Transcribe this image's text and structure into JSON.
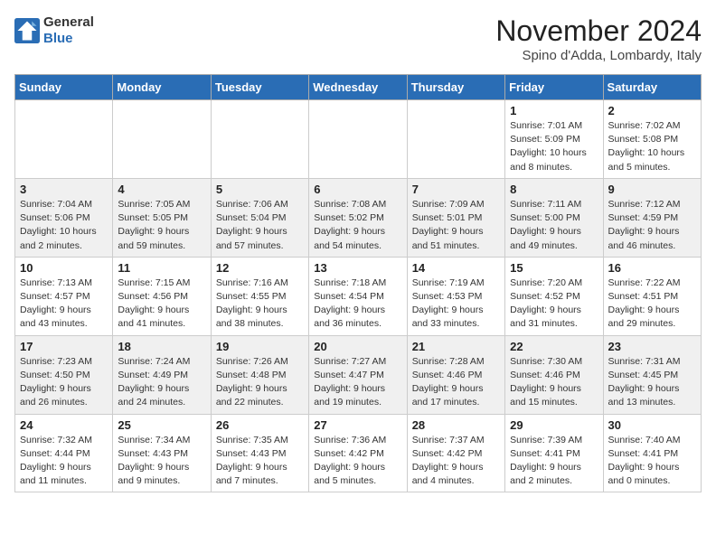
{
  "logo": {
    "line1": "General",
    "line2": "Blue"
  },
  "header": {
    "month": "November 2024",
    "location": "Spino d'Adda, Lombardy, Italy"
  },
  "days_of_week": [
    "Sunday",
    "Monday",
    "Tuesday",
    "Wednesday",
    "Thursday",
    "Friday",
    "Saturday"
  ],
  "weeks": [
    [
      {
        "day": "",
        "info": ""
      },
      {
        "day": "",
        "info": ""
      },
      {
        "day": "",
        "info": ""
      },
      {
        "day": "",
        "info": ""
      },
      {
        "day": "",
        "info": ""
      },
      {
        "day": "1",
        "info": "Sunrise: 7:01 AM\nSunset: 5:09 PM\nDaylight: 10 hours and 8 minutes."
      },
      {
        "day": "2",
        "info": "Sunrise: 7:02 AM\nSunset: 5:08 PM\nDaylight: 10 hours and 5 minutes."
      }
    ],
    [
      {
        "day": "3",
        "info": "Sunrise: 7:04 AM\nSunset: 5:06 PM\nDaylight: 10 hours and 2 minutes."
      },
      {
        "day": "4",
        "info": "Sunrise: 7:05 AM\nSunset: 5:05 PM\nDaylight: 9 hours and 59 minutes."
      },
      {
        "day": "5",
        "info": "Sunrise: 7:06 AM\nSunset: 5:04 PM\nDaylight: 9 hours and 57 minutes."
      },
      {
        "day": "6",
        "info": "Sunrise: 7:08 AM\nSunset: 5:02 PM\nDaylight: 9 hours and 54 minutes."
      },
      {
        "day": "7",
        "info": "Sunrise: 7:09 AM\nSunset: 5:01 PM\nDaylight: 9 hours and 51 minutes."
      },
      {
        "day": "8",
        "info": "Sunrise: 7:11 AM\nSunset: 5:00 PM\nDaylight: 9 hours and 49 minutes."
      },
      {
        "day": "9",
        "info": "Sunrise: 7:12 AM\nSunset: 4:59 PM\nDaylight: 9 hours and 46 minutes."
      }
    ],
    [
      {
        "day": "10",
        "info": "Sunrise: 7:13 AM\nSunset: 4:57 PM\nDaylight: 9 hours and 43 minutes."
      },
      {
        "day": "11",
        "info": "Sunrise: 7:15 AM\nSunset: 4:56 PM\nDaylight: 9 hours and 41 minutes."
      },
      {
        "day": "12",
        "info": "Sunrise: 7:16 AM\nSunset: 4:55 PM\nDaylight: 9 hours and 38 minutes."
      },
      {
        "day": "13",
        "info": "Sunrise: 7:18 AM\nSunset: 4:54 PM\nDaylight: 9 hours and 36 minutes."
      },
      {
        "day": "14",
        "info": "Sunrise: 7:19 AM\nSunset: 4:53 PM\nDaylight: 9 hours and 33 minutes."
      },
      {
        "day": "15",
        "info": "Sunrise: 7:20 AM\nSunset: 4:52 PM\nDaylight: 9 hours and 31 minutes."
      },
      {
        "day": "16",
        "info": "Sunrise: 7:22 AM\nSunset: 4:51 PM\nDaylight: 9 hours and 29 minutes."
      }
    ],
    [
      {
        "day": "17",
        "info": "Sunrise: 7:23 AM\nSunset: 4:50 PM\nDaylight: 9 hours and 26 minutes."
      },
      {
        "day": "18",
        "info": "Sunrise: 7:24 AM\nSunset: 4:49 PM\nDaylight: 9 hours and 24 minutes."
      },
      {
        "day": "19",
        "info": "Sunrise: 7:26 AM\nSunset: 4:48 PM\nDaylight: 9 hours and 22 minutes."
      },
      {
        "day": "20",
        "info": "Sunrise: 7:27 AM\nSunset: 4:47 PM\nDaylight: 9 hours and 19 minutes."
      },
      {
        "day": "21",
        "info": "Sunrise: 7:28 AM\nSunset: 4:46 PM\nDaylight: 9 hours and 17 minutes."
      },
      {
        "day": "22",
        "info": "Sunrise: 7:30 AM\nSunset: 4:46 PM\nDaylight: 9 hours and 15 minutes."
      },
      {
        "day": "23",
        "info": "Sunrise: 7:31 AM\nSunset: 4:45 PM\nDaylight: 9 hours and 13 minutes."
      }
    ],
    [
      {
        "day": "24",
        "info": "Sunrise: 7:32 AM\nSunset: 4:44 PM\nDaylight: 9 hours and 11 minutes."
      },
      {
        "day": "25",
        "info": "Sunrise: 7:34 AM\nSunset: 4:43 PM\nDaylight: 9 hours and 9 minutes."
      },
      {
        "day": "26",
        "info": "Sunrise: 7:35 AM\nSunset: 4:43 PM\nDaylight: 9 hours and 7 minutes."
      },
      {
        "day": "27",
        "info": "Sunrise: 7:36 AM\nSunset: 4:42 PM\nDaylight: 9 hours and 5 minutes."
      },
      {
        "day": "28",
        "info": "Sunrise: 7:37 AM\nSunset: 4:42 PM\nDaylight: 9 hours and 4 minutes."
      },
      {
        "day": "29",
        "info": "Sunrise: 7:39 AM\nSunset: 4:41 PM\nDaylight: 9 hours and 2 minutes."
      },
      {
        "day": "30",
        "info": "Sunrise: 7:40 AM\nSunset: 4:41 PM\nDaylight: 9 hours and 0 minutes."
      }
    ]
  ]
}
